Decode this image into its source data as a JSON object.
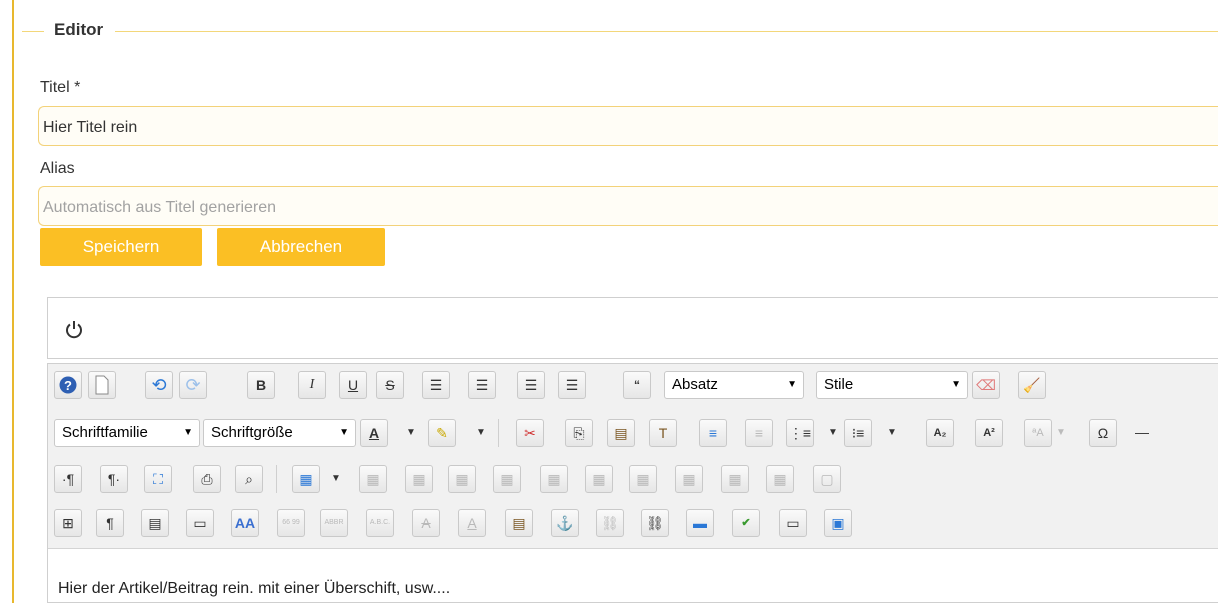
{
  "fieldset": {
    "legend": "Editor"
  },
  "form": {
    "title_label": "Titel *",
    "title_value": "Hier Titel rein",
    "alias_label": "Alias",
    "alias_placeholder": "Automatisch aus Titel generieren",
    "save_label": "Speichern",
    "cancel_label": "Abbrechen"
  },
  "editor": {
    "power_icon": "power-icon",
    "format_select": "Absatz",
    "styles_select": "Stile",
    "font_family_select": "Schriftfamilie",
    "font_size_select": "Schriftgröße",
    "content": "Hier der Artikel/Beitrag rein. mit einer Überschift, usw...."
  },
  "colors": {
    "accent": "#fbbf24",
    "border": "#f3d279",
    "bar": "#e8b82e"
  }
}
